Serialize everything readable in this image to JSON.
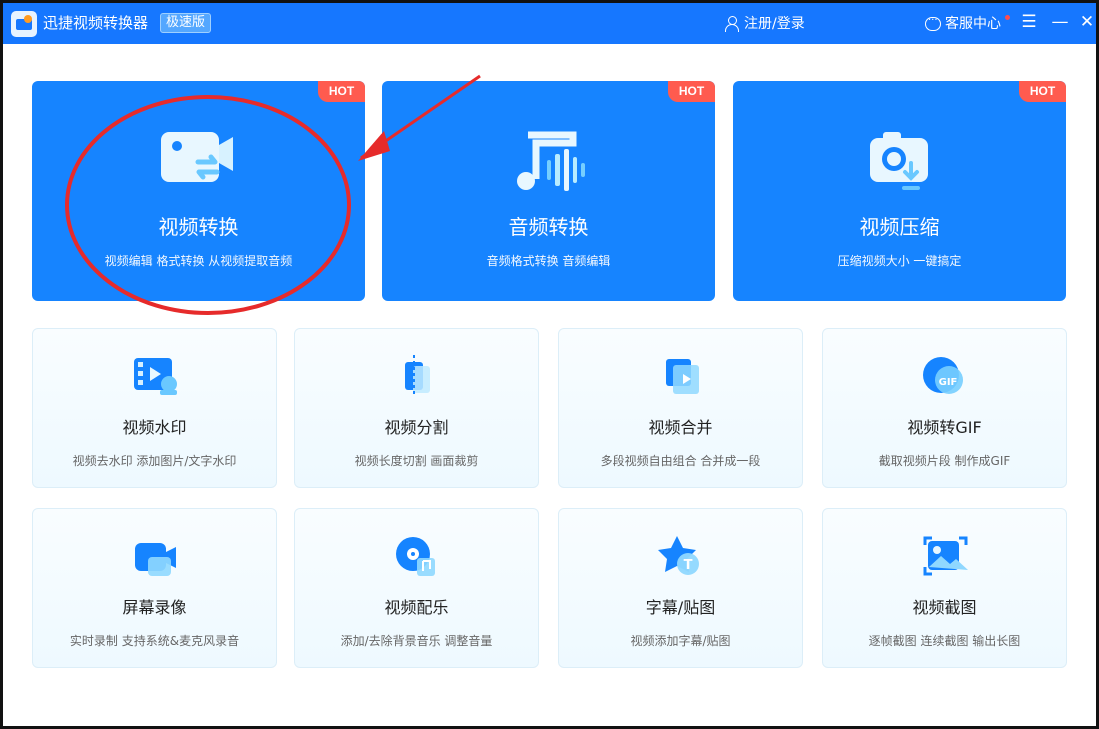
{
  "titlebar": {
    "app_name": "迅捷视频转换器",
    "edition": "极速版",
    "login_label": "注册/登录",
    "service_label": "客服中心",
    "menu": "☰",
    "minimize": "—",
    "close": "✕"
  },
  "feature_cards": [
    {
      "title": "视频转换",
      "desc": "视频编辑 格式转换 从视频提取音频",
      "badge": "HOT",
      "icon": "video-convert-icon"
    },
    {
      "title": "音频转换",
      "desc": "音频格式转换 音频编辑",
      "badge": "HOT",
      "icon": "audio-convert-icon"
    },
    {
      "title": "视频压缩",
      "desc": "压缩视频大小 一键搞定",
      "badge": "HOT",
      "icon": "video-compress-icon"
    }
  ],
  "tool_cards": [
    {
      "title": "视频水印",
      "desc": "视频去水印 添加图片/文字水印",
      "icon": "watermark-icon"
    },
    {
      "title": "视频分割",
      "desc": "视频长度切割 画面裁剪",
      "icon": "split-icon"
    },
    {
      "title": "视频合并",
      "desc": "多段视频自由组合 合并成一段",
      "icon": "merge-icon"
    },
    {
      "title": "视频转GIF",
      "desc": "截取视频片段 制作成GIF",
      "icon": "gif-icon",
      "icon_text": "GIF"
    },
    {
      "title": "屏幕录像",
      "desc": "实时录制 支持系统&麦克风录音",
      "icon": "screen-record-icon"
    },
    {
      "title": "视频配乐",
      "desc": "添加/去除背景音乐 调整音量",
      "icon": "soundtrack-icon"
    },
    {
      "title": "字幕/贴图",
      "desc": "视频添加字幕/贴图",
      "icon": "subtitle-sticker-icon",
      "icon_text": "T"
    },
    {
      "title": "视频截图",
      "desc": "逐帧截图 连续截图 输出长图",
      "icon": "screenshot-icon"
    }
  ],
  "colors": {
    "brand_blue": "#1677ff",
    "card_blue": "#1684ff",
    "hot_red": "#ff5b4f",
    "annotation_red": "#e62b2b"
  }
}
